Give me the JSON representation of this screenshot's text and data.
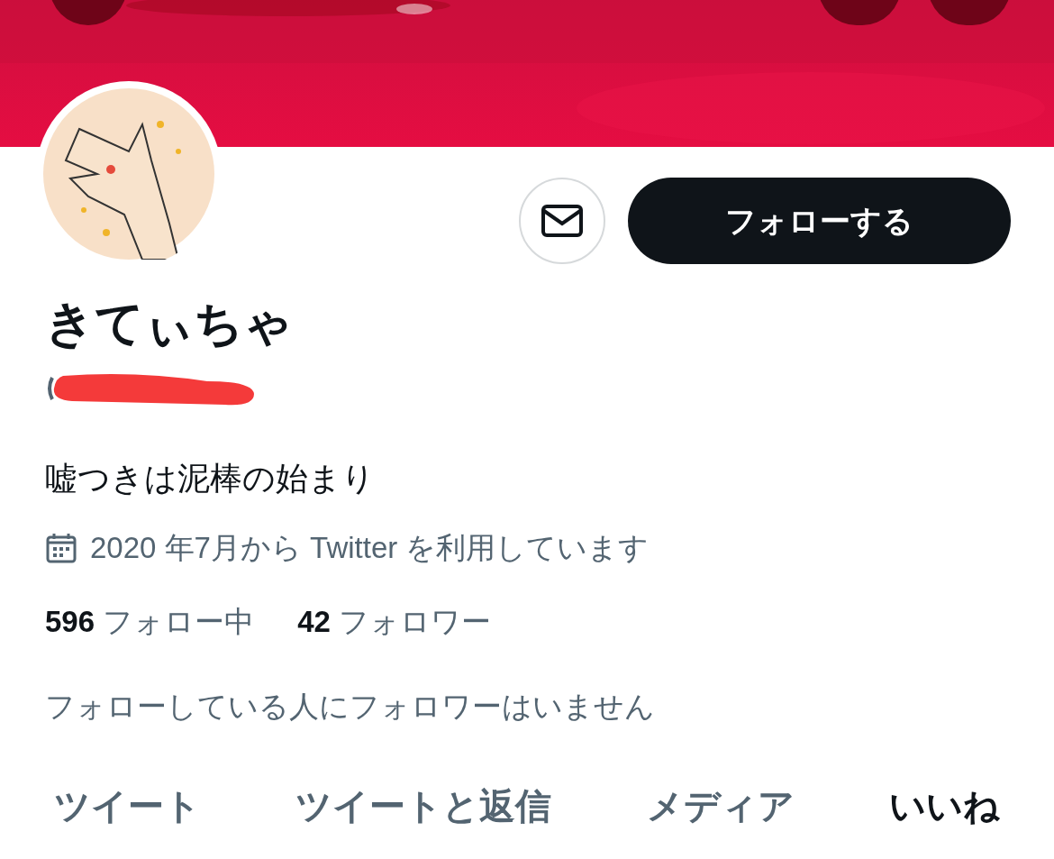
{
  "profile": {
    "name": "きてぃちゃ",
    "bio": "嘘つきは泥棒の始まり",
    "joined": "2020 年7月から Twitter を利用しています"
  },
  "follow_button": {
    "label": "フォローする"
  },
  "stats": [
    "**596** フォロー中",
    "**42** フォロワー"
  ],
  "followers_note": "フォローしている人にフォロワーはいません",
  "tabs": [
    {
      "label": "ツイート",
      "selected": false
    },
    {
      "label": "ツイートと返信",
      "selected": false
    },
    {
      "label": "メディア",
      "selected": false
    },
    {
      "label": "いいね",
      "selected": true
    }
  ]
}
